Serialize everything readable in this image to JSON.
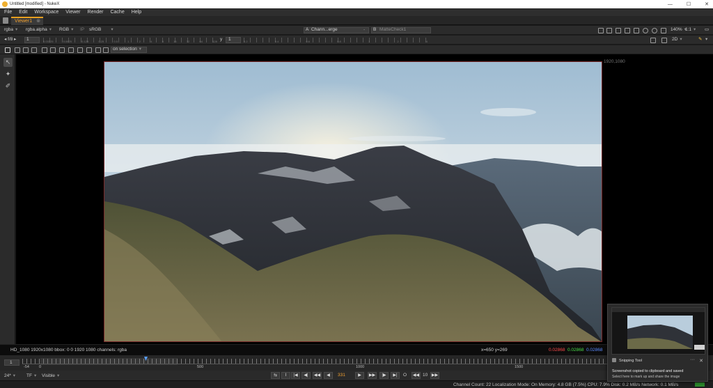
{
  "window": {
    "title": "Untitled [modified] - NukeX",
    "controls": [
      "—",
      "☐",
      "✕"
    ]
  },
  "menu": [
    "File",
    "Edit",
    "Workspace",
    "Viewer",
    "Render",
    "Cache",
    "Help"
  ],
  "tabs": [
    {
      "label": "Viewer1",
      "close": "⊗"
    }
  ],
  "viewer_toolbar": {
    "channels": "rgba",
    "alpha": "rgba.alpha",
    "display": "RGB",
    "lut_prefix": "IP",
    "lut": "sRGB",
    "input_a_prefix": "A",
    "input_a": "Chann...erge",
    "input_a_value": "-",
    "input_b_prefix": "B",
    "input_b": "MatteCheck1",
    "zoom": "140%",
    "ratio": "1:1"
  },
  "exposure_toolbar": {
    "fstop": "f/8",
    "gain": "1",
    "gain_ticks": [
      "0.03125",
      "0.0625",
      "0.125",
      "0.25",
      "0.5",
      "1",
      "2",
      "4",
      "8",
      "16",
      "32",
      "64",
      "128"
    ],
    "gamma_label": "y",
    "gamma": "1",
    "gamma_ticks": [
      "0.2",
      "0.4",
      "0.6",
      "0.8",
      "1",
      "2",
      "4"
    ],
    "view_mode": "2D"
  },
  "tools_toolbar": {
    "selection_mode": "on selection"
  },
  "viewport": {
    "format_label": "1920,1080",
    "image_colors": {
      "sky_top": "#a9c3d6",
      "sky_bottom": "#dfe6ea",
      "mountain": "#2f3238",
      "grass": "#6b6a48"
    }
  },
  "info_bar": {
    "format": "HD_1080 1920x1080  bbox: 0 0 1920 1080 channels: rgba",
    "coords": "x=650 y=269",
    "r": "0.02868",
    "g": "0.02868",
    "b": "0.02868",
    "r_color": "#ff4a4a",
    "g_color": "#4adf4a",
    "b_color": "#5a8aff"
  },
  "timeline": {
    "frame_field": "1",
    "labels": [
      "-54",
      "0",
      "500",
      "1000",
      "1500"
    ],
    "current_frame": 331
  },
  "transport": {
    "fps": "24*",
    "tf": "TF",
    "visible": "Visible",
    "frame": "331",
    "step": "10",
    "buttons": [
      "|◀",
      "◀|",
      "◀◀",
      "◀",
      "▶",
      "▶▶",
      "|▶",
      "▶|"
    ],
    "loop": "O"
  },
  "statusbar": {
    "text": "Channel Count: 22  Localization Mode: On  Memory: 4.8 GB (7.5%)  CPU: 7.9%  Disk: 0.2 MB/s  Network: 0.1 MB/s"
  },
  "toast": {
    "app": "Snipping Tool",
    "line1": "Screenshot copied to clipboard and saved",
    "line2": "Select here to mark up and share the image",
    "more": "···",
    "close": "✕"
  }
}
